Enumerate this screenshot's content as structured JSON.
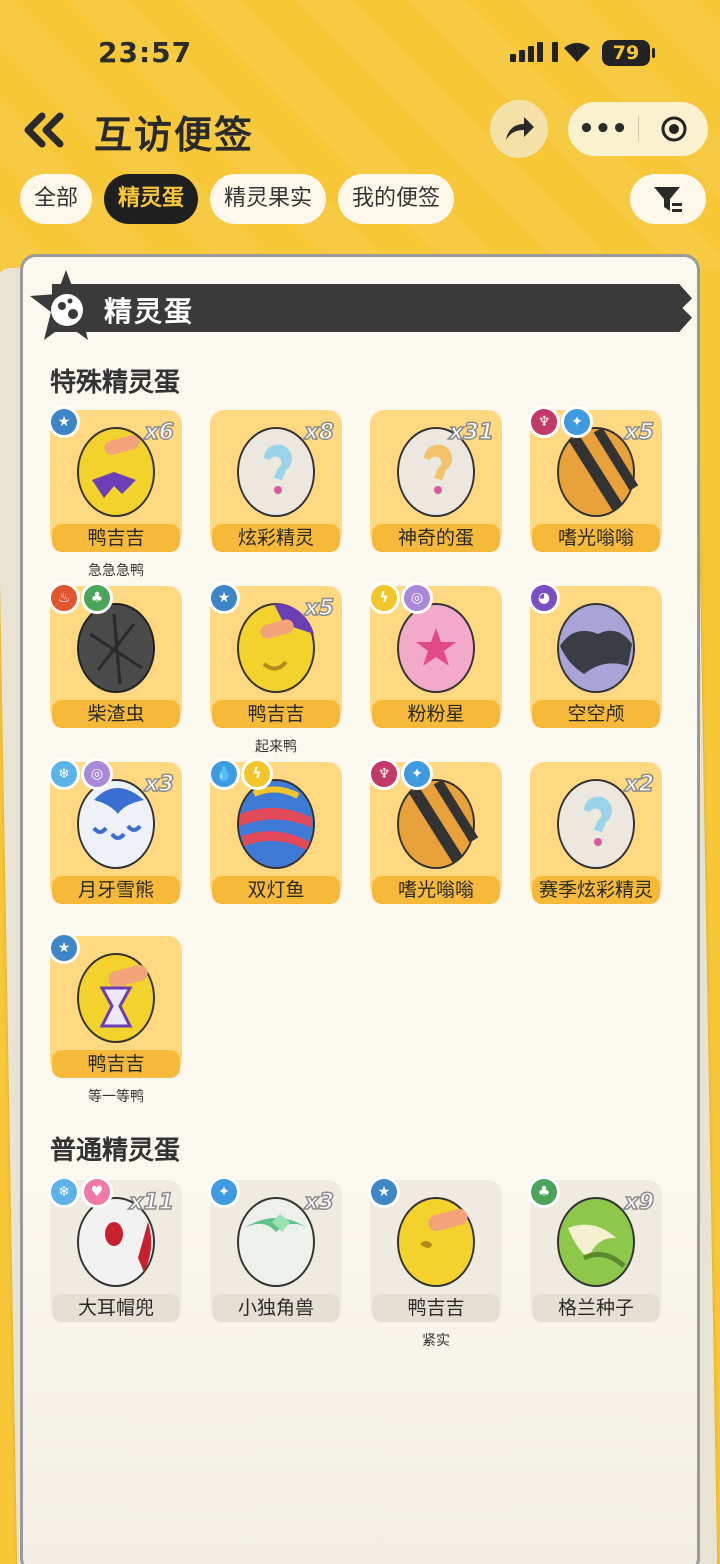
{
  "status": {
    "time": "23:57",
    "battery": "79"
  },
  "header": {
    "title": "互访便签"
  },
  "tabs": [
    "全部",
    "精灵蛋",
    "精灵果实",
    "我的便签"
  ],
  "banner": {
    "title": "精灵蛋"
  },
  "sections": {
    "special": "特殊精灵蛋",
    "normal": "普通精灵蛋"
  },
  "special": [
    {
      "name": "鸭吉吉",
      "count": "x6",
      "sub": "急急急鸭"
    },
    {
      "name": "炫彩精灵",
      "count": "x8",
      "sub": ""
    },
    {
      "name": "神奇的蛋",
      "count": "x31",
      "sub": ""
    },
    {
      "name": "嗜光嗡嗡",
      "count": "x5",
      "sub": ""
    },
    {
      "name": "柴渣虫",
      "count": "",
      "sub": ""
    },
    {
      "name": "鸭吉吉",
      "count": "x5",
      "sub": "起来鸭"
    },
    {
      "name": "粉粉星",
      "count": "",
      "sub": ""
    },
    {
      "name": "空空颅",
      "count": "",
      "sub": ""
    },
    {
      "name": "月牙雪熊",
      "count": "x3",
      "sub": ""
    },
    {
      "name": "双灯鱼",
      "count": "",
      "sub": ""
    },
    {
      "name": "嗜光嗡嗡",
      "count": "",
      "sub": ""
    },
    {
      "name": "赛季炫彩精灵",
      "count": "x2",
      "sub": ""
    },
    {
      "name": "鸭吉吉",
      "count": "",
      "sub": "等一等鸭"
    }
  ],
  "normal": [
    {
      "name": "大耳帽兜",
      "count": "x11",
      "sub": ""
    },
    {
      "name": "小独角兽",
      "count": "x3",
      "sub": ""
    },
    {
      "name": "鸭吉吉",
      "count": "",
      "sub": "紧实"
    },
    {
      "name": "格兰种子",
      "count": "x9",
      "sub": ""
    }
  ]
}
